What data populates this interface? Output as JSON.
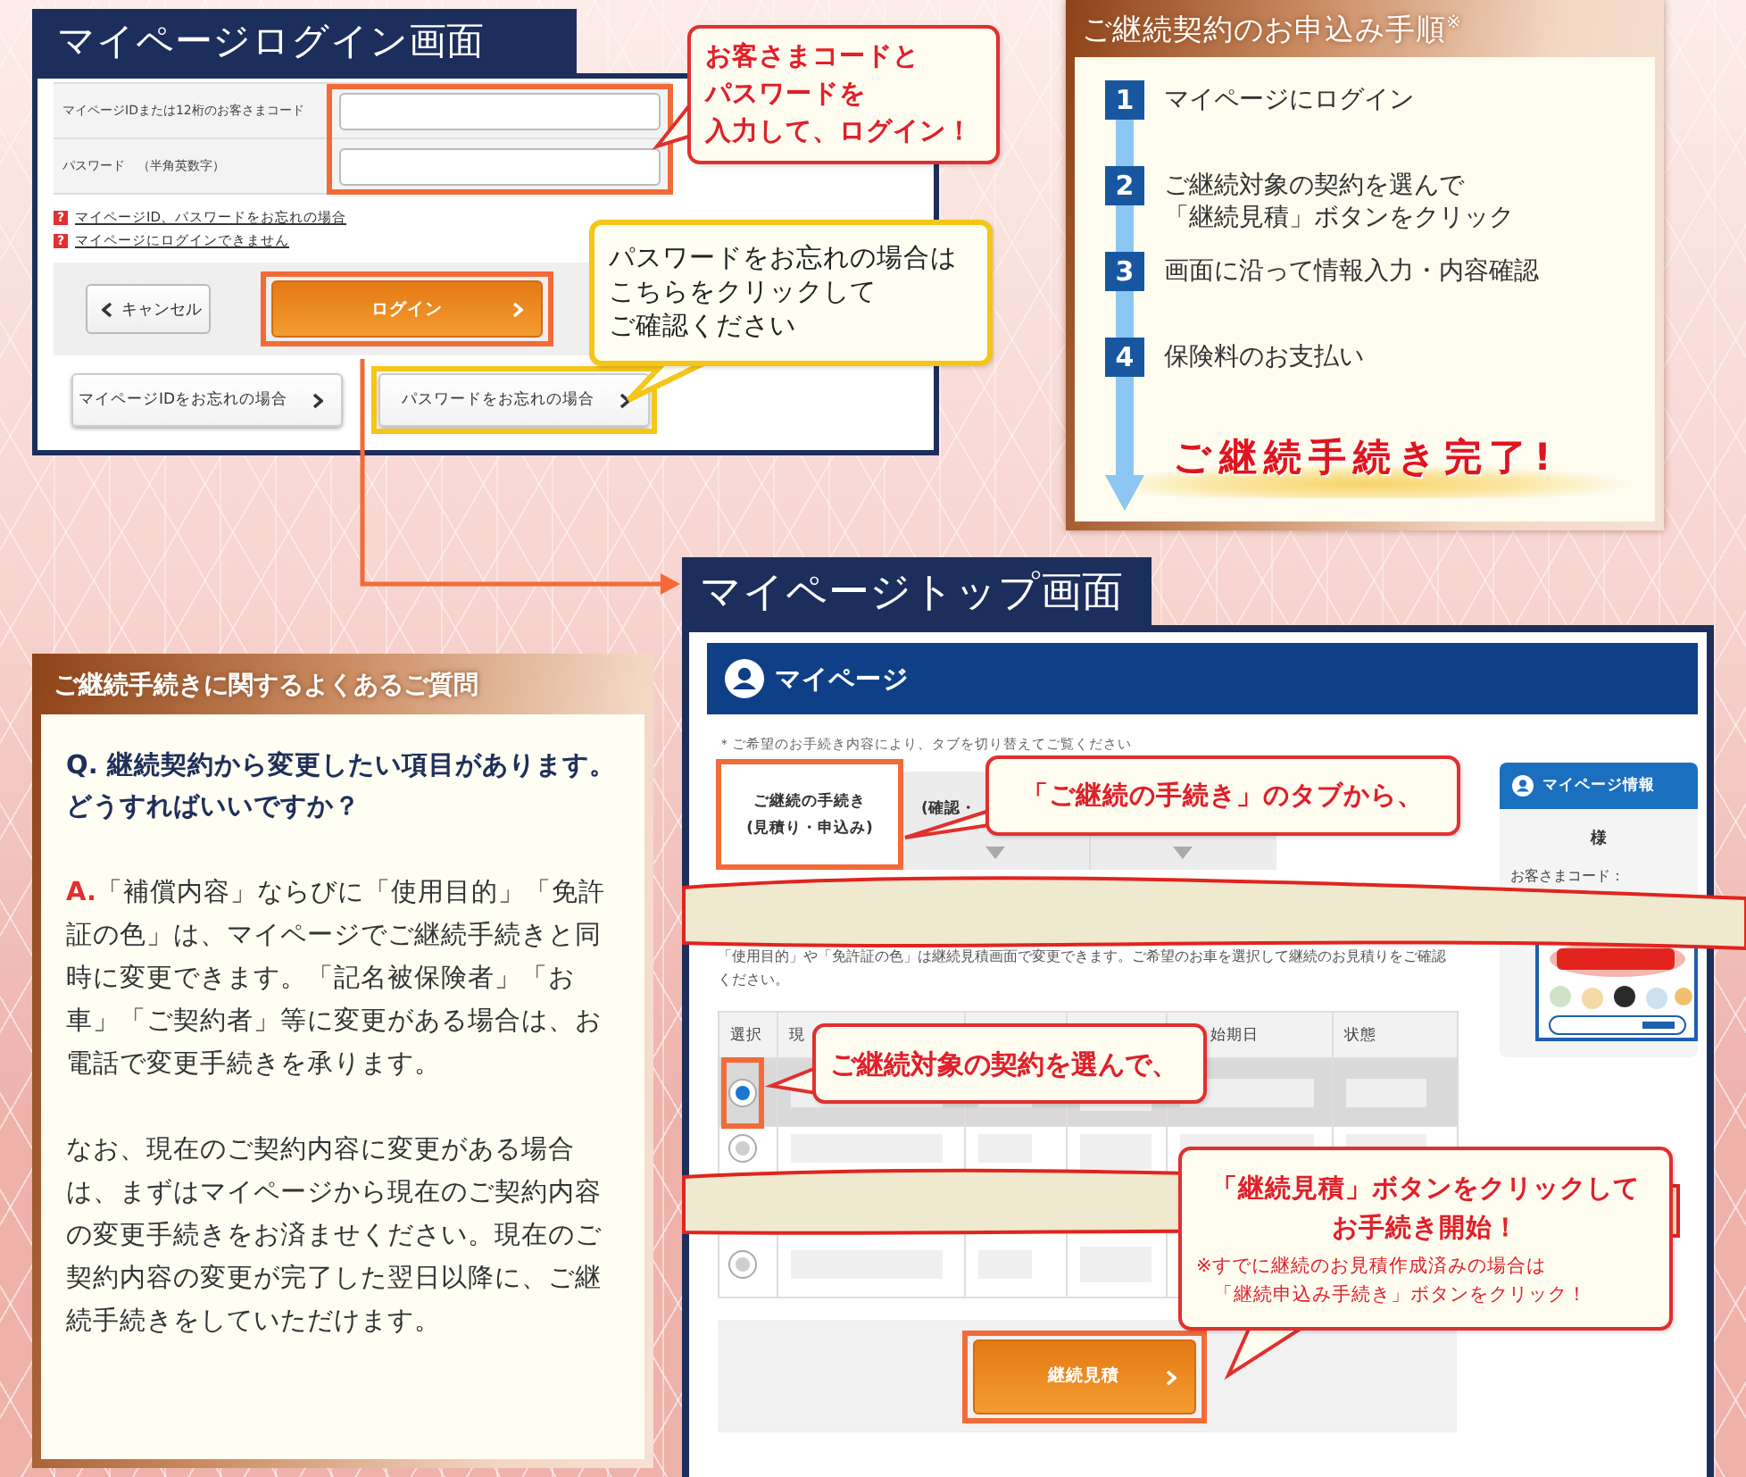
{
  "login_screen": {
    "title": "マイページログイン画面",
    "fields": [
      {
        "label": "マイページIDまたは12桁のお客さまコード"
      },
      {
        "label": "パスワード　（半角英数字）"
      }
    ],
    "help_links": [
      {
        "icon": "?",
        "text": "マイページID、パスワードをお忘れの場合"
      },
      {
        "icon": "?",
        "text": "マイページにログインできません"
      }
    ],
    "cancel_button": "キャンセル",
    "login_button": "ログイン",
    "forgot_buttons": [
      "マイページIDをお忘れの場合",
      "パスワードをお忘れの場合"
    ],
    "callouts": [
      {
        "kind": "alert",
        "lines": [
          "お客さまコードと",
          "パスワードを",
          "入力して、ログイン！"
        ]
      },
      {
        "kind": "hint",
        "lines": [
          "パスワードをお忘れの場合は",
          "こちらをクリックして",
          "ご確認ください"
        ]
      }
    ]
  },
  "steps_panel": {
    "title": "ご継続契約のお申込み手順$^{※}$",
    "steps": [
      {
        "number": "1",
        "lines": [
          "マイページにログイン"
        ]
      },
      {
        "number": "2",
        "lines": [
          "ご継続対象の契約を選んで",
          "「継続見積」ボタンをクリック"
        ]
      },
      {
        "number": "3",
        "lines": [
          "画面に沿って情報入力・内容確認"
        ]
      },
      {
        "number": "4",
        "lines": [
          "保険料のお支払い"
        ]
      }
    ],
    "completion": "ご継続手続き完了!"
  },
  "faq": {
    "title": "ご継続手続きに関するよくあるご質問",
    "question_mark": "Q.",
    "question": "継続契約から変更したい項目があります。どうすればいいですか？",
    "answer_mark": "A.",
    "answers": [
      "「補償内容」ならびに「使用目的」「免許証の色」は、マイページでご継続手続きと同時に変更できます。「記名被保険者」「お車」「ご契約者」等に変更がある場合は、お電話で変更手続きを承ります。",
      "なお、現在のご契約内容に変更がある場合は、まずはマイページから現在のご契約内容の変更手続きをお済ませください。現在のご契約内容の変更が完了した翌日以降に、ご継続手続きをしていただけます。"
    ]
  },
  "mypage_screen": {
    "title": "マイページトップ画面",
    "header": "マイページ",
    "tab_note": "＊ご希望のお手続き内容により、タブを切り替えてご覧ください",
    "tabs": [
      {
        "lines": [
          "ご継続の手続き",
          "(見積り・申込み)"
        ],
        "selected": true
      },
      {
        "lines": [
          "(確認・"
        ],
        "selected": false
      },
      {
        "selected": false
      }
    ],
    "note": "「使用目的」や「免許証の色」は継続見積画面で変更できます。ご希望のお車を選択して継続のお見積りをご確認ください。",
    "table": {
      "columns": [
        "選択",
        "現",
        null,
        null,
        "始期日",
        "状態"
      ],
      "rows": [
        {
          "selected": true
        },
        {
          "selected": false
        },
        {
          "selected": false
        }
      ]
    },
    "estimate_button": "継続見積",
    "side_panel": {
      "title": "マイページ情報",
      "honorific": "様",
      "customer_code_label": "お客さまコード："
    },
    "callouts": [
      {
        "kind": "alert",
        "lines": [
          "「ご継続の手続き」のタブから、"
        ]
      },
      {
        "kind": "alert",
        "lines": [
          "ご継続対象の契約を選んで、"
        ]
      },
      {
        "kind": "alert",
        "lines": [
          "「継続見積」ボタンをクリックして",
          "お手続き開始！"
        ],
        "note_lines": [
          "※すでに継続のお見積作成済みの場合は",
          "「継続申込み手続き」ボタンをクリック！"
        ]
      }
    ]
  }
}
